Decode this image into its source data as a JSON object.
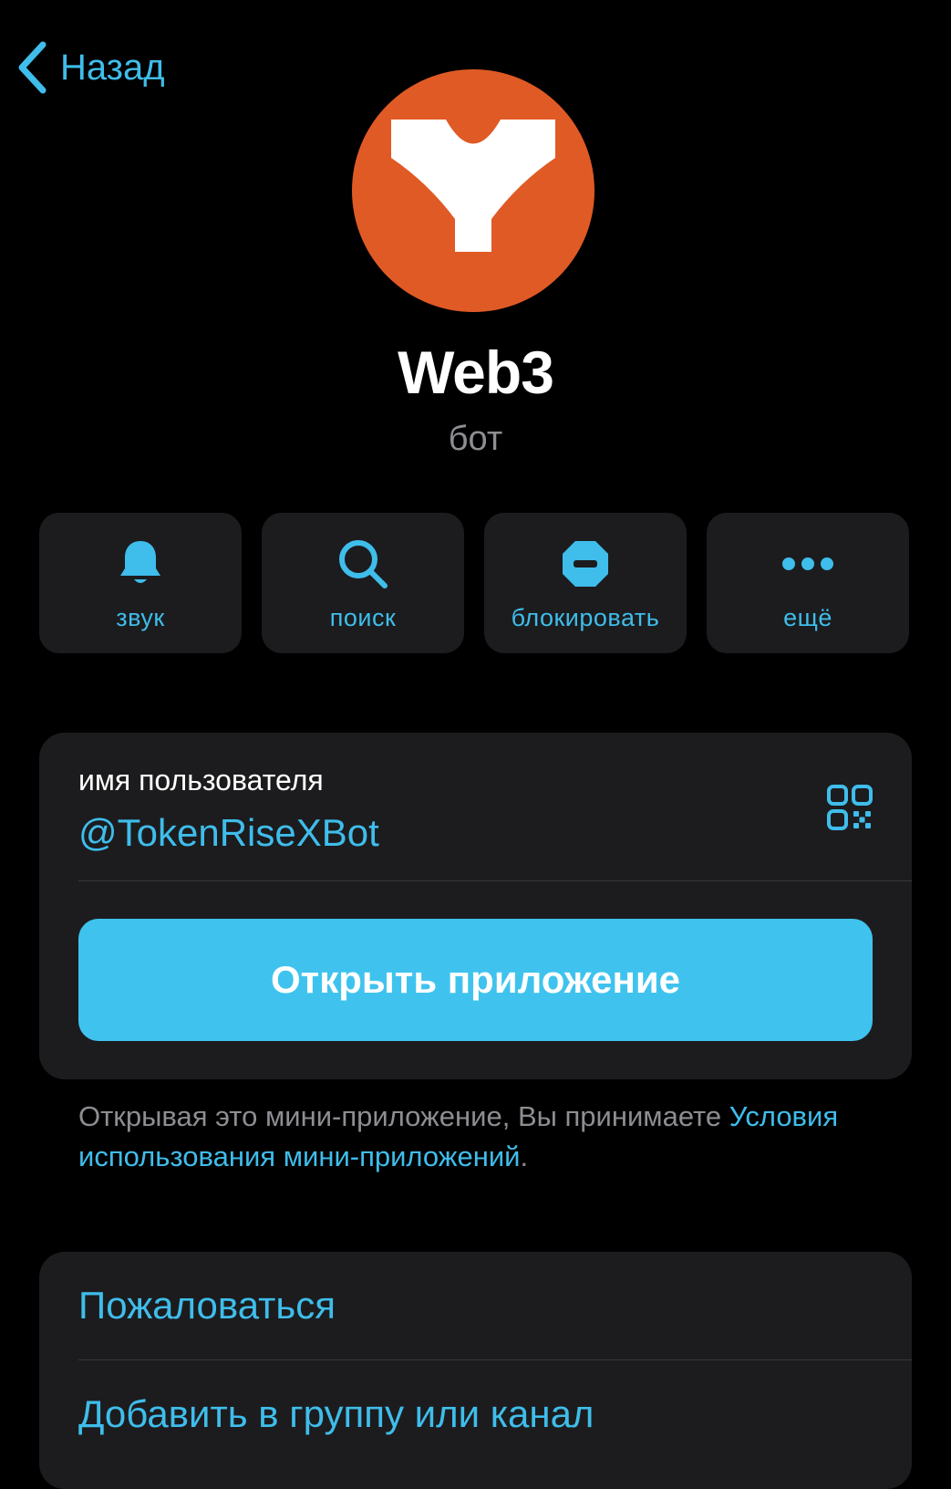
{
  "nav": {
    "back_label": "Назад"
  },
  "profile": {
    "name": "Web3",
    "subtitle": "бот",
    "avatar_color": "#e05a25"
  },
  "actions": [
    {
      "icon": "bell-icon",
      "label": "звук"
    },
    {
      "icon": "search-icon",
      "label": "поиск"
    },
    {
      "icon": "block-icon",
      "label": "блокировать"
    },
    {
      "icon": "more-icon",
      "label": "ещё"
    }
  ],
  "username": {
    "caption": "имя пользователя",
    "handle": "@TokenRiseXBot",
    "icon": "qr-code-icon"
  },
  "open_app": {
    "label": "Открыть приложение"
  },
  "terms": {
    "prefix": "Открывая это мини-приложение, Вы принимаете ",
    "link": "Условия использования мини-приложений",
    "suffix": "."
  },
  "menu": [
    {
      "label": "Пожаловаться"
    },
    {
      "label": "Добавить в группу или канал"
    }
  ],
  "colors": {
    "background": "#000000",
    "card": "#1c1c1e",
    "accent": "#3fbdeb",
    "button": "#3fc3ee",
    "secondary_text": "#8d8d92"
  }
}
